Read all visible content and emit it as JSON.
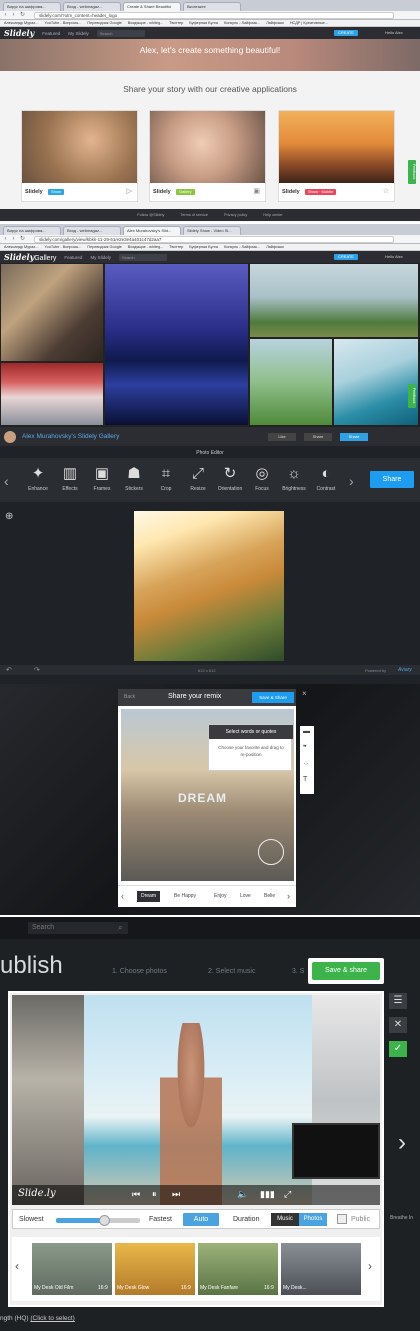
{
  "section1": {
    "browser": {
      "tabs": [
        "Вирус на шифрова...",
        "Вход - webmagaz...",
        "Create & Share Beautiful",
        "Вконтакте"
      ],
      "url": "slidely.com/?utm_content=header_logo",
      "bookmarks": [
        "Александр Мурах...",
        "YouTube - Вопросы...",
        "Переводчик Google",
        "Входящие - whiteg...",
        "Твиттер",
        "Буферная Булга",
        "Конкуль - Лайфхак...",
        "Лайфхаки",
        "НСДР | Креативные..."
      ]
    },
    "nav": {
      "logo": "Slidely",
      "links": [
        "Featured",
        "My Slidely"
      ],
      "search_placeholder": "Search",
      "create": "CREATE",
      "user": "Hello Alex"
    },
    "hero_text": "Alex, let's create something beautiful!",
    "share_title": "Share your story with our creative applications",
    "cards": [
      {
        "name": "Slidely",
        "badge": "Show",
        "badge_color": "#29a8e0"
      },
      {
        "name": "Slidely",
        "badge": "Gallery",
        "badge_color": "#8cc63f"
      },
      {
        "name": "Slidely",
        "badge": "Show · Mobile",
        "badge_color": "#e8475f"
      }
    ],
    "footer": [
      "Follow @Slidely",
      "Terms of service",
      "Privacy policy",
      "Help center"
    ],
    "feedback": "Feedback"
  },
  "section2": {
    "browser": {
      "tabs": [
        "Вирус на шифрова...",
        "Вход - webmagaz...",
        "Alex Murahovsky's Slid...",
        "Slidely Show - Video Sl..."
      ],
      "url": "slidely.com/gallery/view/kbkk-11-29-51/e2e3e4a401c47d2aa7"
    },
    "nav": {
      "logo": "Slidely",
      "logo_suffix": "Gallery",
      "links": [
        "Featured",
        "My Slidely"
      ],
      "search_placeholder": "Search",
      "create": "CREATE",
      "user": "Hello Alex"
    },
    "gallery_owner": "Alex Murahovsky's Slidely Gallery",
    "actions": [
      "Like",
      "Share",
      "Share"
    ],
    "feedback": "Feedback"
  },
  "section3": {
    "title": "Photo Editor",
    "tools": [
      "Enhance",
      "Effects",
      "Frames",
      "Stickers",
      "Crop",
      "Resize",
      "Orientation",
      "Focus",
      "Brightness",
      "Contrast"
    ],
    "share": "Share",
    "size": "612 x 612",
    "powered": "Powered by",
    "brand": "Aviary"
  },
  "section4": {
    "back": "Back",
    "title": "Share your remix",
    "save": "Save & Share",
    "hint_title": "Select words or quotes",
    "hint_body": "Choose your favorite and drag to re-position",
    "overlay_word": "DREAM",
    "chips": [
      "Dream",
      "Be Happy",
      "Enjoy",
      "Love",
      "Belie"
    ]
  },
  "section5": {
    "search_placeholder": "Search",
    "heading": "ublish",
    "steps": [
      "1. Choose photos",
      "2. Select music",
      "3. S"
    ],
    "save": "Save & share",
    "brand": "Slide.ly",
    "speed_slow": "Slowest",
    "speed_fast": "Fastest",
    "auto": "Auto",
    "duration": "Duration",
    "music": "Music",
    "photos": "Photos",
    "public": "Public",
    "themes": [
      {
        "name": "My Desk Old Film",
        "ratio": "16:9"
      },
      {
        "name": "My Desk Glow",
        "ratio": "16:9"
      },
      {
        "name": "My Desk Fanfare",
        "ratio": "16:9"
      },
      {
        "name": "My Desk...",
        "ratio": ""
      }
    ],
    "side_text": "Breathe In",
    "bottom_text": "ngth (HQ)",
    "bottom_link": "(Click to select)"
  }
}
